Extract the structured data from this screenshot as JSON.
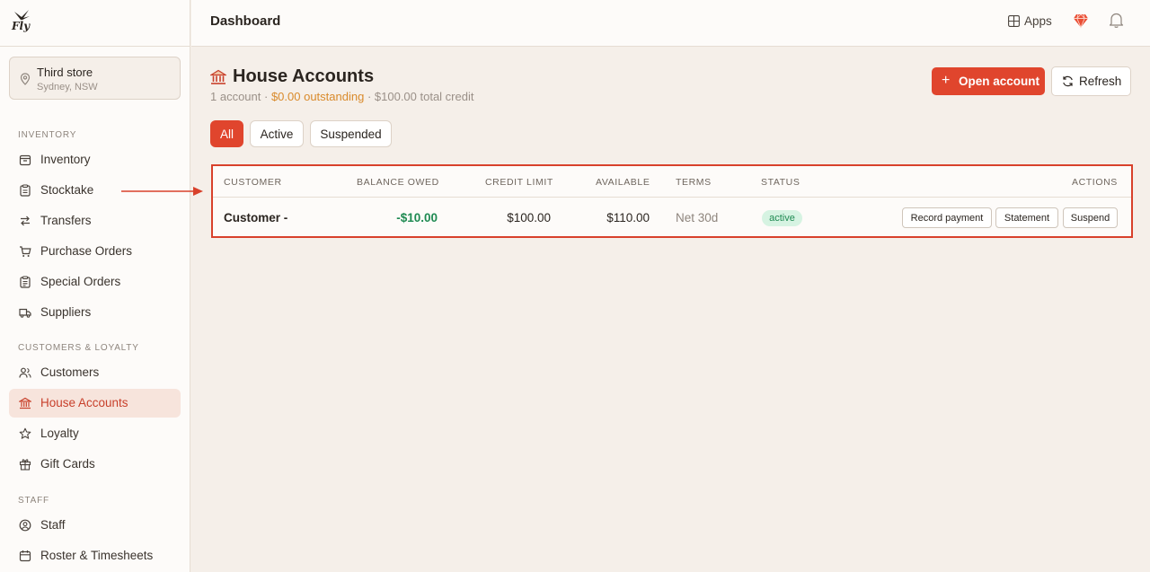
{
  "brand": {
    "logo_text": "Fly"
  },
  "store": {
    "name": "Third store",
    "location": "Sydney, NSW"
  },
  "sidebar": {
    "sections": [
      {
        "title": "INVENTORY"
      },
      {
        "title": "CUSTOMERS & LOYALTY"
      },
      {
        "title": "STAFF"
      }
    ],
    "items": [
      {
        "label": "Inventory",
        "icon": "box-icon"
      },
      {
        "label": "Stocktake",
        "icon": "clipboard-icon"
      },
      {
        "label": "Transfers",
        "icon": "transfer-icon"
      },
      {
        "label": "Purchase Orders",
        "icon": "cart-icon"
      },
      {
        "label": "Special Orders",
        "icon": "clipboard-list-icon"
      },
      {
        "label": "Suppliers",
        "icon": "truck-icon"
      },
      {
        "label": "Customers",
        "icon": "users-icon"
      },
      {
        "label": "House Accounts",
        "icon": "bank-icon",
        "active": true
      },
      {
        "label": "Loyalty",
        "icon": "star-icon"
      },
      {
        "label": "Gift Cards",
        "icon": "gift-icon"
      },
      {
        "label": "Staff",
        "icon": "user-circle-icon"
      },
      {
        "label": "Roster & Timesheets",
        "icon": "calendar-icon"
      }
    ]
  },
  "topbar": {
    "title": "Dashboard",
    "apps_label": "Apps"
  },
  "page": {
    "title": "House Accounts",
    "summary_count": "1 account ·",
    "summary_outstanding": "$0.00 outstanding",
    "summary_credit": "· $100.00 total credit",
    "open_account_label": "Open account",
    "refresh_label": "Refresh"
  },
  "filters": [
    {
      "label": "All",
      "selected": true
    },
    {
      "label": "Active",
      "selected": false
    },
    {
      "label": "Suspended",
      "selected": false
    }
  ],
  "table": {
    "headers": {
      "customer": "CUSTOMER",
      "balance": "BALANCE OWED",
      "credit": "CREDIT LIMIT",
      "available": "AVAILABLE",
      "terms": "TERMS",
      "status": "STATUS",
      "actions": "ACTIONS"
    },
    "rows": [
      {
        "customer": "Customer -",
        "balance": "-$10.00",
        "credit": "$100.00",
        "available": "$110.00",
        "terms": "Net 30d",
        "status": "active",
        "actions": [
          "Record payment",
          "Statement",
          "Suspend"
        ]
      }
    ]
  },
  "colors": {
    "accent": "#e0452d",
    "balance_negative": "#1f8a52",
    "outstanding": "#d98a2b",
    "highlight_box": "#d8412b"
  }
}
